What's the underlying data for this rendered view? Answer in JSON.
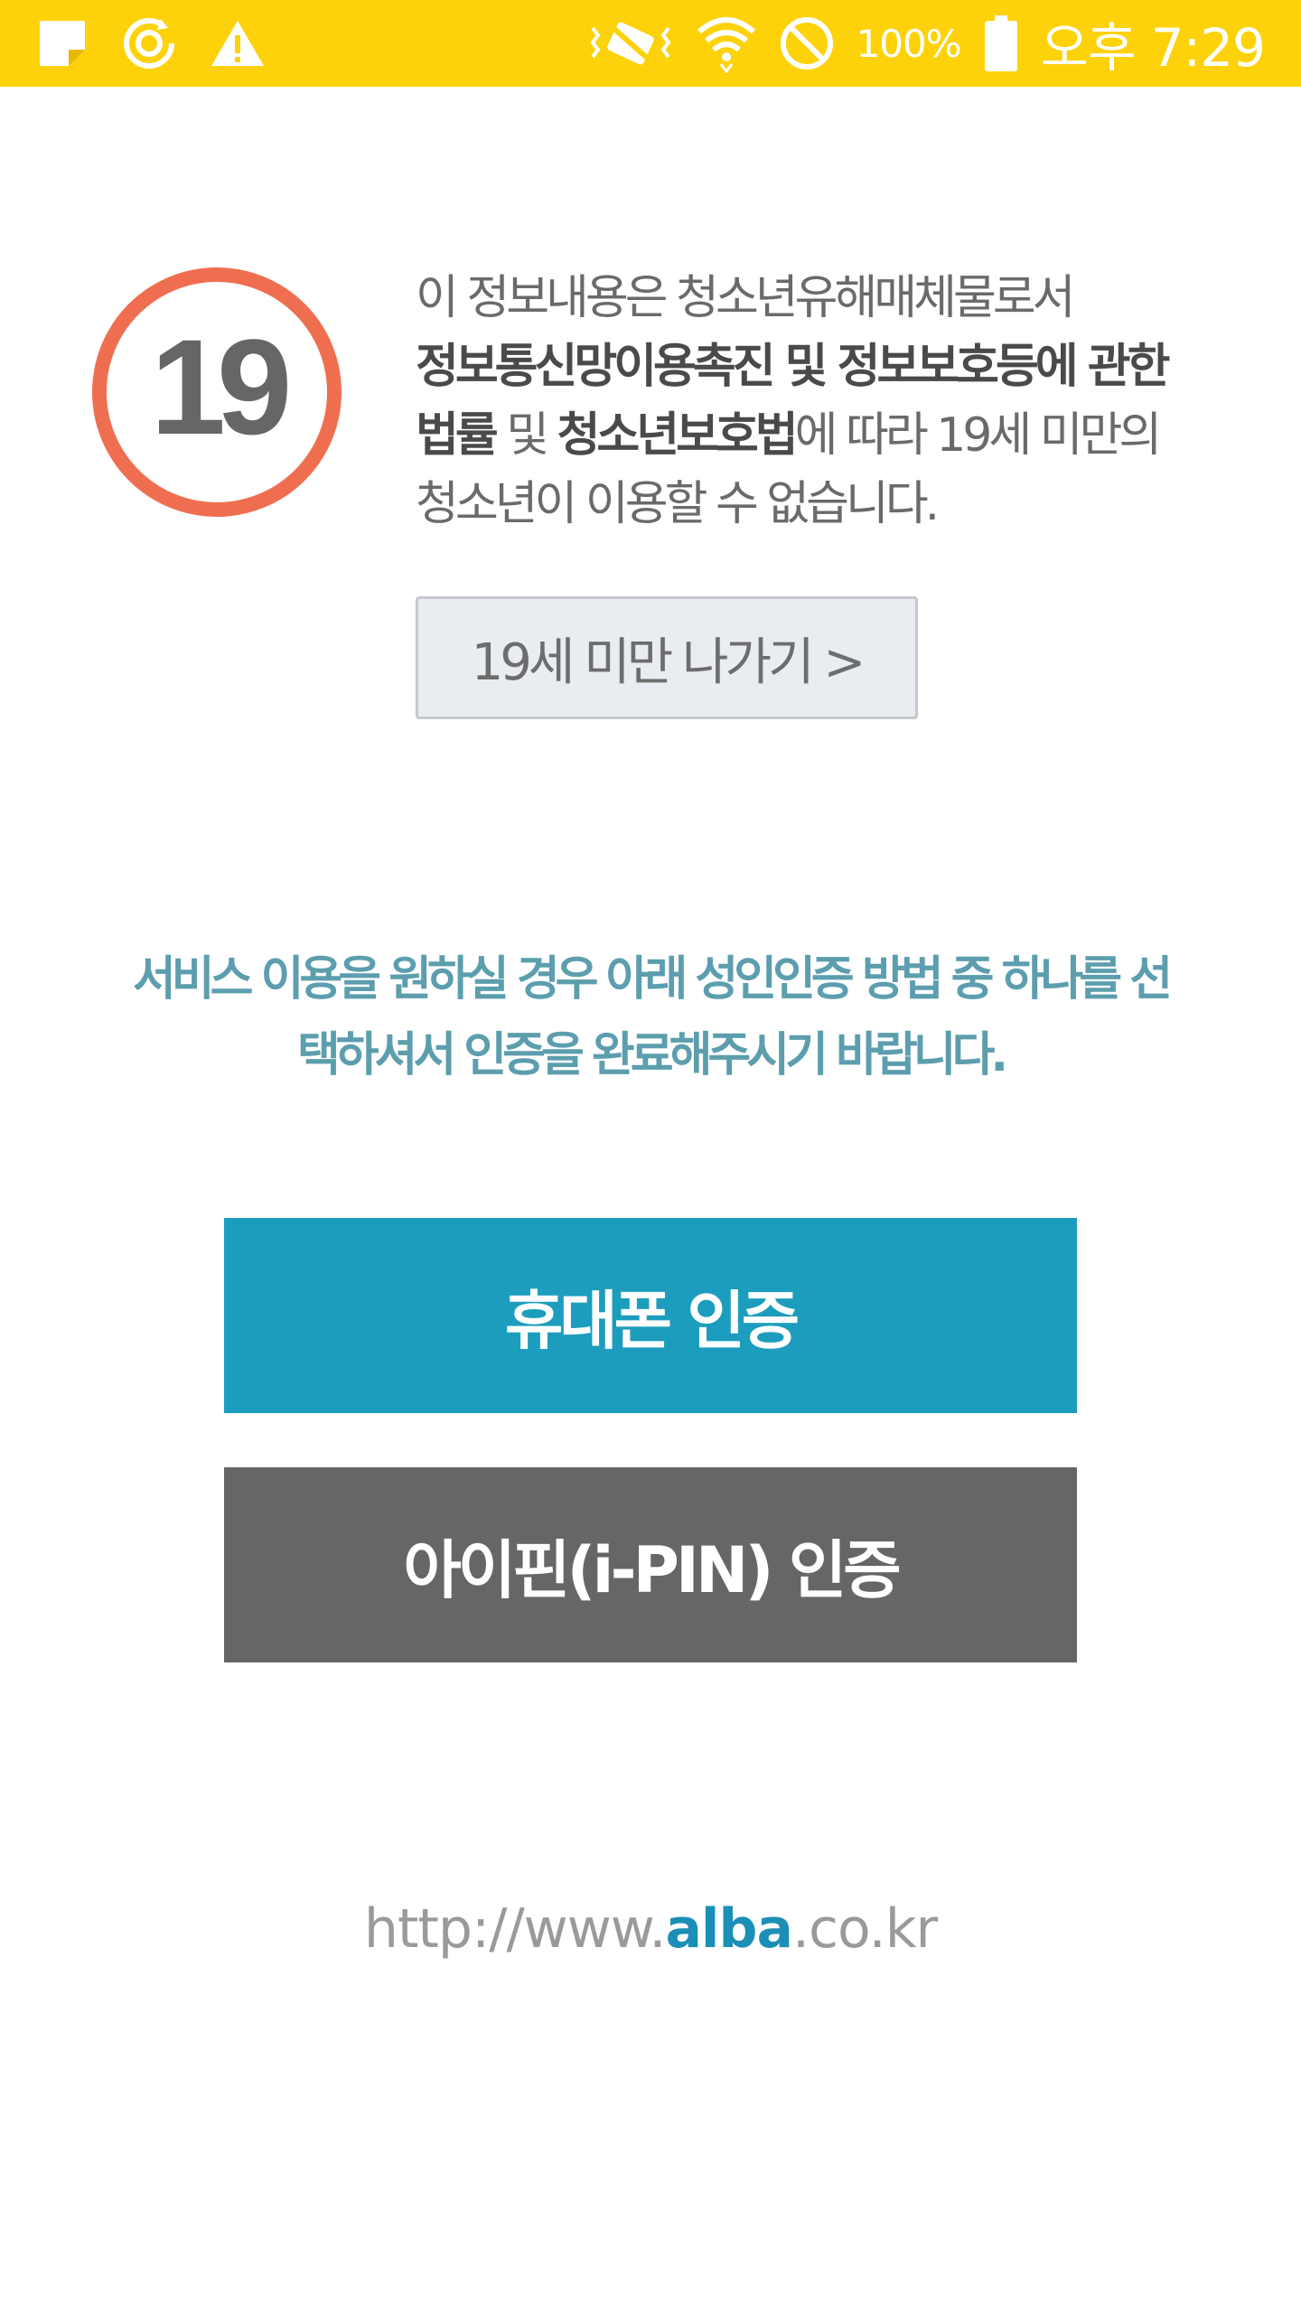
{
  "status_bar": {
    "background": "#fdd20a",
    "left_icons": [
      "sticky-note-icon",
      "sync-icon",
      "warning-icon"
    ],
    "right_icons": [
      "vibrate-icon",
      "wifi-icon",
      "do-not-disturb-icon",
      "battery-icon"
    ],
    "battery_text": "100%",
    "clock": "오후 7:29"
  },
  "notice": {
    "badge_number": "19",
    "text_part1": "이 정보내용은 청소년유해매체물로서 ",
    "text_bold1": "정보통신망이용촉진 및 정보보호등에 관한 법률",
    "text_part2": " 및 ",
    "text_bold2": "청소년보호법",
    "text_part3": "에 따라 19세 미만의 청소년이 이용할 수 없습니다.",
    "under19_button": "19세 미만 나가기 >"
  },
  "guide": {
    "line1": "서비스 이용을 원하실 경우 아래 성인인증 방법 중 하나를 선",
    "line2": "택하셔서 인증을 완료해주시기 바랍니다."
  },
  "auth": {
    "phone_label": "휴대폰 인증",
    "ipin_label": "아이핀(i-PIN) 인증",
    "phone_color": "#1c9dbd",
    "ipin_color": "#666666"
  },
  "footer": {
    "url_prefix": "http://www.",
    "url_brand": "alba",
    "url_suffix": ".co.kr"
  }
}
